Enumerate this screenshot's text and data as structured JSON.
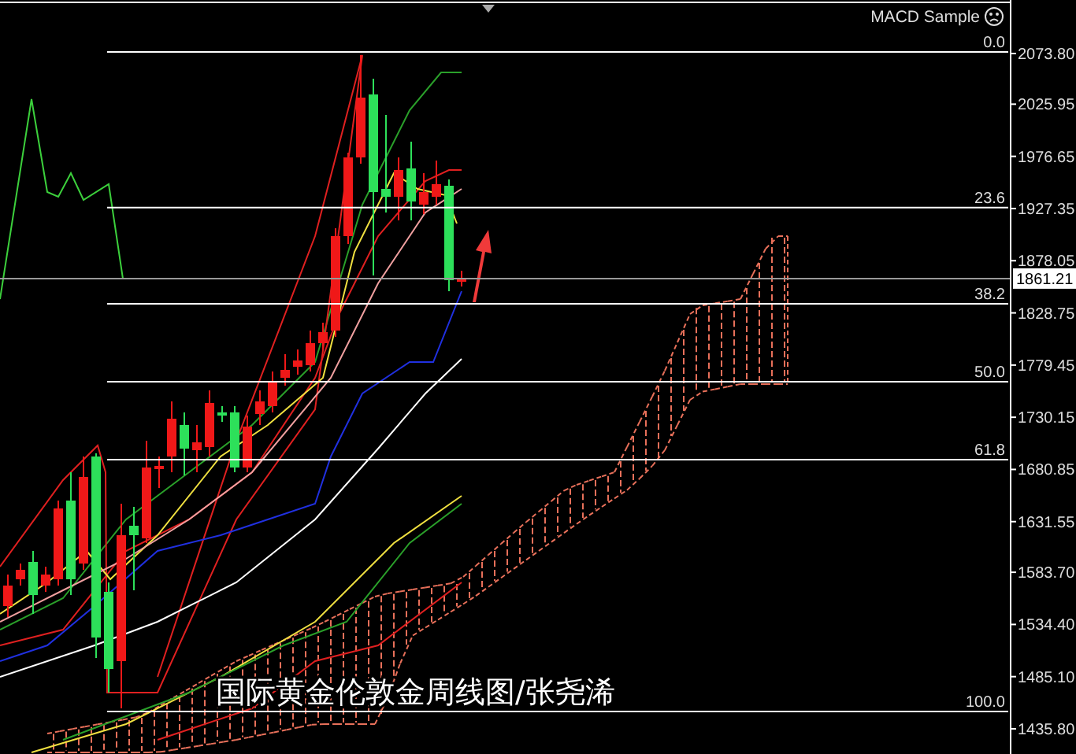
{
  "chart": {
    "indicator_label": "MACD Sample",
    "fib_levels": [
      "0.0",
      "23.6",
      "38.2",
      "50.0",
      "61.8",
      "100.0"
    ],
    "price_axis": [
      "2073.80",
      "2025.95",
      "1976.65",
      "1927.35",
      "1878.05",
      "1828.75",
      "1779.45",
      "1730.15",
      "1680.85",
      "1631.55",
      "1583.70",
      "1534.40",
      "1485.10",
      "1435.80"
    ],
    "current_price": "1861.21",
    "caption": "国际黄金伦敦金周线图/张尧浠"
  }
}
